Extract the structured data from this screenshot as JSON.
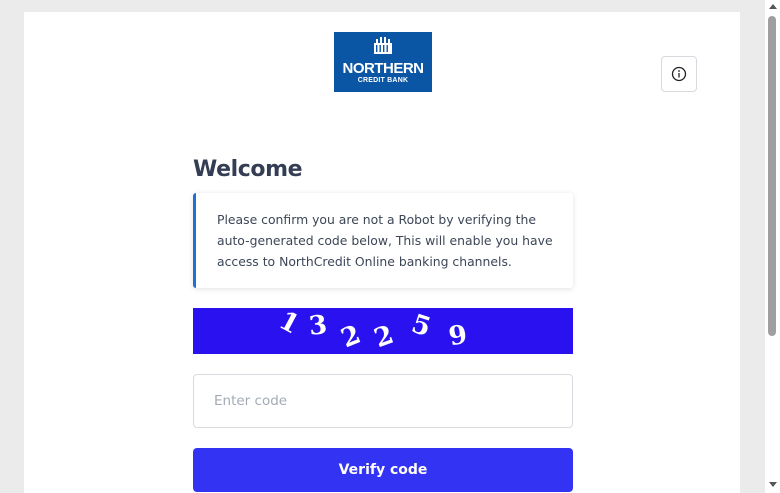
{
  "logo": {
    "name": "NORTHERN",
    "subtitle": "CREDIT BANK",
    "background": "#0b55a5"
  },
  "header": {
    "info_icon": "info-circle-icon"
  },
  "main": {
    "heading": "Welcome",
    "notice": "Please confirm you are not a Robot by verifying the auto-generated code below, This will enable you have access to NorthCredit Online banking channels.",
    "captcha": {
      "characters": [
        "1",
        "3",
        "2",
        "2",
        "5",
        "9"
      ],
      "background": "#2a12f0"
    },
    "code_input": {
      "placeholder": "Enter code",
      "value": ""
    },
    "verify_button": "Verify code",
    "accent_color": "#3333f4"
  }
}
